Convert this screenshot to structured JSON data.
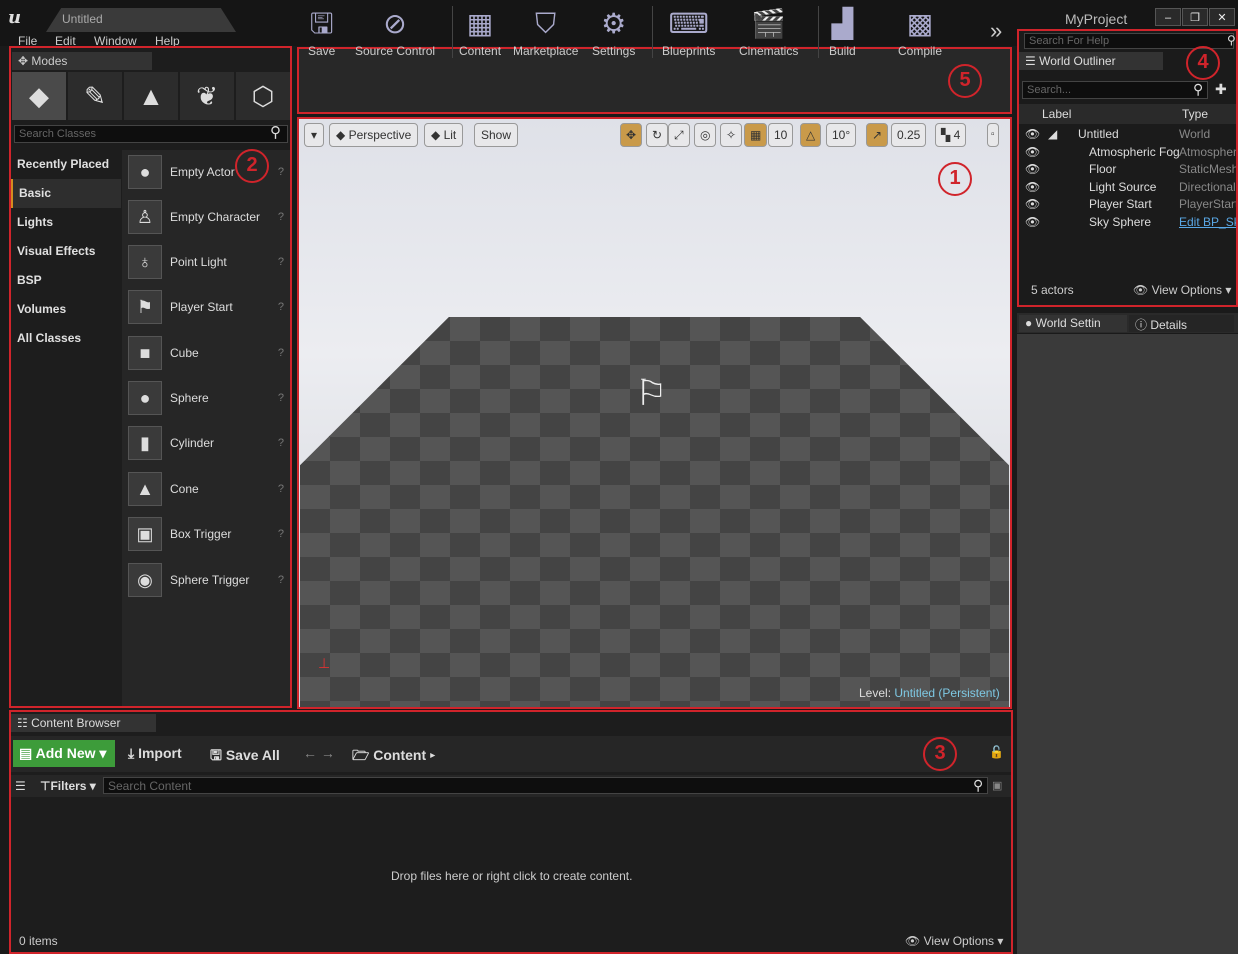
{
  "window": {
    "doc_tab": "Untitled",
    "project": "MyProject",
    "controls": [
      "‒",
      "❐",
      "✕"
    ]
  },
  "menu": {
    "items": [
      "File",
      "Edit",
      "Window",
      "Help"
    ]
  },
  "modes": {
    "tab_label": "Modes",
    "search_placeholder": "Search Classes",
    "categories": [
      "Recently Placed",
      "Basic",
      "Lights",
      "Visual Effects",
      "BSP",
      "Volumes",
      "All Classes"
    ],
    "items": [
      "Empty Actor",
      "Empty Character",
      "Point Light",
      "Player Start",
      "Cube",
      "Sphere",
      "Cylinder",
      "Cone",
      "Box Trigger",
      "Sphere Trigger"
    ]
  },
  "toolbar": {
    "buttons": [
      "Save",
      "Source Control",
      "Content",
      "Marketplace",
      "Settings",
      "Blueprints",
      "Cinematics",
      "Build",
      "Compile"
    ],
    "overflow": "»"
  },
  "viewport": {
    "perspective": "Perspective",
    "lit": "Lit",
    "show": "Show",
    "grid_snap": "10",
    "rot_snap": "10°",
    "scale_snap": "0.25",
    "cam_speed": "4",
    "level_label": "Level:",
    "level_name": "Untitled (Persistent)"
  },
  "help": {
    "search_placeholder": "Search For Help"
  },
  "outliner": {
    "tab_label": "World Outliner",
    "search_placeholder": "Search...",
    "col_label": "Label",
    "col_type": "Type",
    "rows": [
      {
        "name": "Untitled",
        "type": "World"
      },
      {
        "name": "Atmospheric Fog",
        "type": "Atmospher"
      },
      {
        "name": "Floor",
        "type": "StaticMesh"
      },
      {
        "name": "Light Source",
        "type": "Directional"
      },
      {
        "name": "Player Start",
        "type": "PlayerStart"
      },
      {
        "name": "Sky Sphere",
        "type": "Edit BP_Sk"
      }
    ],
    "count": "5 actors",
    "view_options": "View Options"
  },
  "details": {
    "tab_world": "World Settin",
    "tab_details": "Details"
  },
  "content_browser": {
    "tab_label": "Content Browser",
    "add_new": "Add New",
    "import": "Import",
    "save_all": "Save All",
    "path": "Content",
    "filters": "Filters",
    "search_placeholder": "Search Content",
    "drop_hint": "Drop files here or right click to create content.",
    "count": "0 items",
    "view_options": "View Options"
  },
  "callouts": [
    "1",
    "2",
    "3",
    "4",
    "5"
  ]
}
